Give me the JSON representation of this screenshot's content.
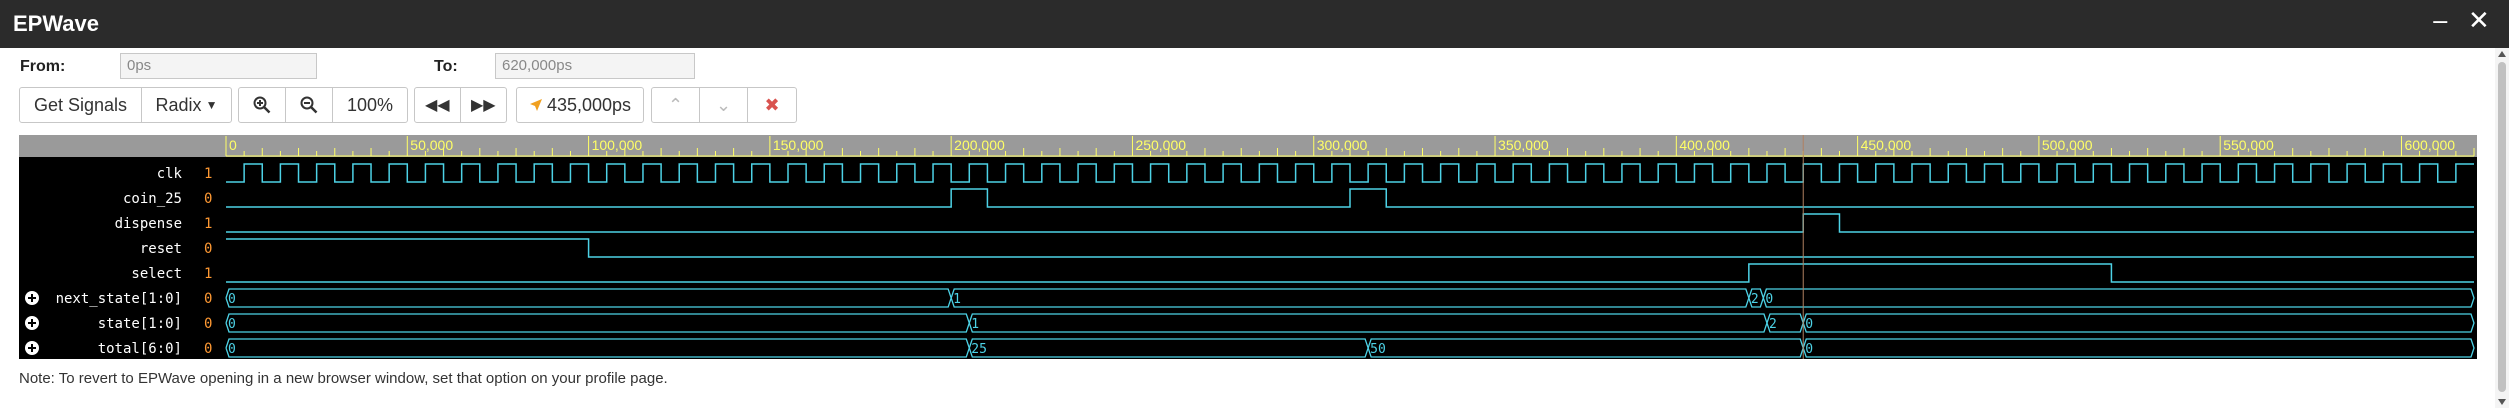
{
  "window": {
    "title": "EPWave",
    "minimize_icon": "minimize-icon",
    "close_icon": "close-icon"
  },
  "range": {
    "from_label": "From:",
    "from_value": "0ps",
    "to_label": "To:",
    "to_value": "620,000ps"
  },
  "toolbar": {
    "get_signals": "Get Signals",
    "radix": "Radix",
    "zoom_level": "100%",
    "cursor_time": "435,000ps"
  },
  "colors": {
    "axis": "#ffff66",
    "wave": "#4dd2e6",
    "clock": "#4dd2e6",
    "value_name": "#ffffff",
    "value": "#ff9933",
    "cursor": "#b08060",
    "timeline_bg": "#9a9a9a"
  },
  "timeline": {
    "ticks": [
      "0",
      "50,000",
      "100,000",
      "150,000",
      "200,000",
      "250,000",
      "300,000",
      "350,000",
      "400,000",
      "450,000",
      "500,000",
      "550,000",
      "600,000"
    ]
  },
  "signals": [
    {
      "name": "clk",
      "value": "1",
      "expandable": false
    },
    {
      "name": "coin_25",
      "value": "0",
      "expandable": false
    },
    {
      "name": "dispense",
      "value": "1",
      "expandable": false
    },
    {
      "name": "reset",
      "value": "0",
      "expandable": false
    },
    {
      "name": "select",
      "value": "1",
      "expandable": false
    },
    {
      "name": "next_state[1:0]",
      "value": "0",
      "expandable": true,
      "bus_labels": [
        "0",
        "1",
        "2",
        "0"
      ]
    },
    {
      "name": "state[1:0]",
      "value": "0",
      "expandable": true,
      "bus_labels": [
        "0",
        "1",
        "2",
        "0"
      ]
    },
    {
      "name": "total[6:0]",
      "value": "0",
      "expandable": true,
      "bus_labels": [
        "0",
        "25",
        "50",
        "0"
      ]
    }
  ],
  "note": "Note: To revert to EPWave opening in a new browser window, set that option on your profile page."
}
